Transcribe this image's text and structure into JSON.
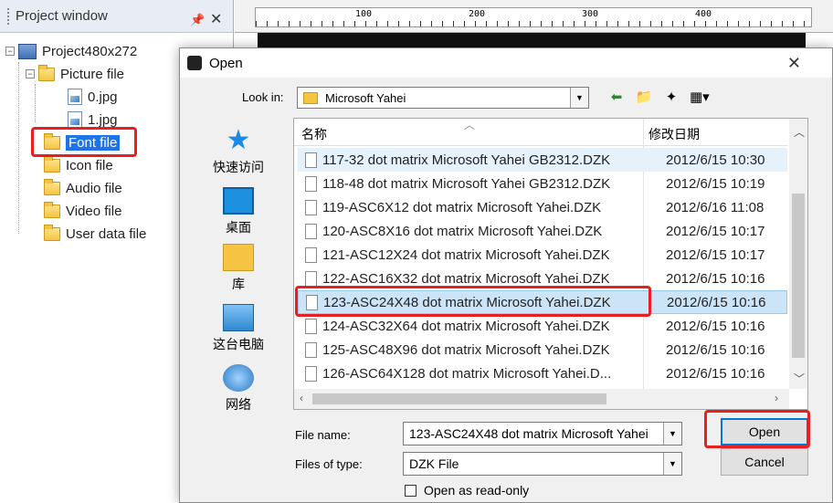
{
  "project_window": {
    "title": "Project window",
    "pin_icon": "pin-icon",
    "close_icon": "close-icon",
    "tree": {
      "root": "Project480x272",
      "items": [
        {
          "label": "Picture file",
          "icon": "folder-icon"
        },
        {
          "label": "0.jpg",
          "icon": "image-file-icon"
        },
        {
          "label": "1.jpg",
          "icon": "image-file-icon"
        },
        {
          "label": "Font file",
          "icon": "folder-icon"
        },
        {
          "label": "Icon file",
          "icon": "folder-icon"
        },
        {
          "label": "Audio file",
          "icon": "folder-icon"
        },
        {
          "label": "Video file",
          "icon": "folder-icon"
        },
        {
          "label": "User data file",
          "icon": "folder-icon"
        }
      ]
    }
  },
  "ruler": {
    "labels": [
      "100",
      "200",
      "300",
      "400"
    ]
  },
  "dialog": {
    "title": "Open",
    "look_in_label": "Look in:",
    "look_in_value": "Microsoft Yahei",
    "places": [
      {
        "label": "快速访问",
        "icon": "star-icon"
      },
      {
        "label": "桌面",
        "icon": "desktop-icon"
      },
      {
        "label": "库",
        "icon": "library-icon"
      },
      {
        "label": "这台电脑",
        "icon": "computer-icon"
      },
      {
        "label": "网络",
        "icon": "network-icon"
      }
    ],
    "columns": {
      "name": "名称",
      "date": "修改日期"
    },
    "files": [
      {
        "name": "117-32 dot matrix Microsoft Yahei GB2312.DZK",
        "date": "2012/6/15 10:30"
      },
      {
        "name": "118-48 dot matrix Microsoft Yahei GB2312.DZK",
        "date": "2012/6/15 10:19"
      },
      {
        "name": "119-ASC6X12 dot matrix Microsoft Yahei.DZK",
        "date": "2012/6/16 11:08"
      },
      {
        "name": "120-ASC8X16 dot matrix Microsoft Yahei.DZK",
        "date": "2012/6/15 10:17"
      },
      {
        "name": "121-ASC12X24 dot matrix Microsoft Yahei.DZK",
        "date": "2012/6/15 10:17"
      },
      {
        "name": "122-ASC16X32 dot matrix Microsoft Yahei.DZK",
        "date": "2012/6/15 10:16"
      },
      {
        "name": "123-ASC24X48 dot matrix Microsoft Yahei.DZK",
        "date": "2012/6/15 10:16"
      },
      {
        "name": "124-ASC32X64 dot matrix Microsoft Yahei.DZK",
        "date": "2012/6/15 10:16"
      },
      {
        "name": "125-ASC48X96 dot matrix Microsoft Yahei.DZK",
        "date": "2012/6/15 10:16"
      },
      {
        "name": "126-ASC64X128 dot matrix Microsoft Yahei.D...",
        "date": "2012/6/15 10:16"
      }
    ],
    "selected_file_index": 6,
    "file_name_label": "File name:",
    "file_name_value": "123-ASC24X48 dot matrix Microsoft Yahei",
    "files_of_type_label": "Files of type:",
    "files_of_type_value": "DZK File",
    "read_only_label": "Open as read-only",
    "open_button": "Open",
    "cancel_button": "Cancel"
  },
  "colors": {
    "highlight": "#1e73e8",
    "annotation": "#e62020",
    "selection": "#cce4f7"
  }
}
